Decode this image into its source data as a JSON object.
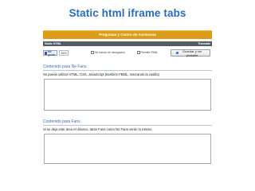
{
  "slide": {
    "title": "Static html iframe tabs"
  },
  "app": {
    "header_title": "Preguntas y Centro de Asistencia"
  },
  "tabs": {
    "active": "Static HTML",
    "translate": "Translate"
  },
  "toolbar": {
    "like_label": "Me gusta",
    "like_count": "3600",
    "checkbox1": "Sin barras de navegación",
    "checkbox2": "Permitir FBML",
    "save_label": "Guardar y ver pestaña"
  },
  "section_nofans": {
    "title": "Contenido para No Fans",
    "desc": "Se puede utilizar HTML, CSS, JavaScript (también FBML, marcando la casilla)"
  },
  "section_fans": {
    "title": "Contenido para Fans",
    "desc": "Si se deja este área en blanco, tanto Fans como No Fans verán lo mismo"
  },
  "colors": {
    "title_blue": "#2a6db5",
    "header_orange": "#dd9c17",
    "tab_dark": "#555b63",
    "facebook_blue": "#3b5998",
    "section_blue": "#3b6bb3"
  }
}
